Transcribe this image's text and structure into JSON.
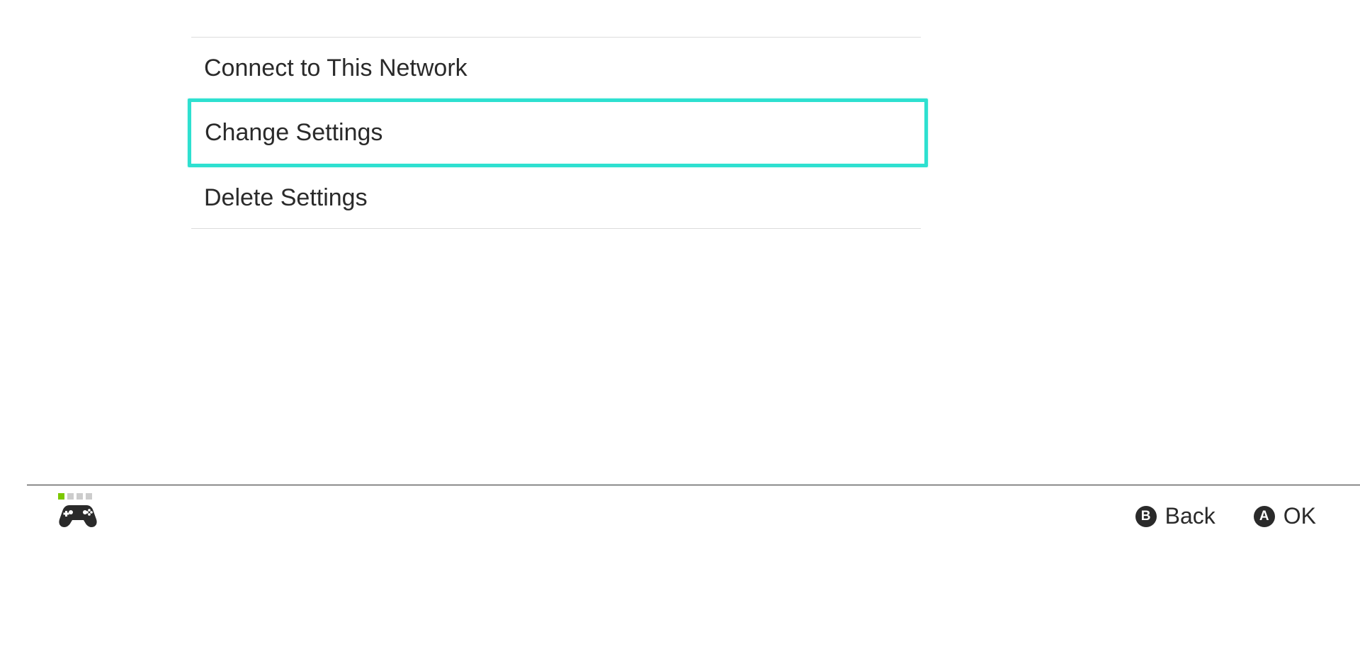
{
  "menu": {
    "items": [
      {
        "label": "Connect to This Network",
        "selected": false
      },
      {
        "label": "Change Settings",
        "selected": true
      },
      {
        "label": "Delete Settings",
        "selected": false
      }
    ]
  },
  "footer": {
    "controller": {
      "player_active": 1,
      "player_total": 4
    },
    "hints": [
      {
        "button": "B",
        "label": "Back"
      },
      {
        "button": "A",
        "label": "OK"
      }
    ]
  },
  "colors": {
    "highlight": "#2ee0d0",
    "player_active": "#7cc800"
  }
}
